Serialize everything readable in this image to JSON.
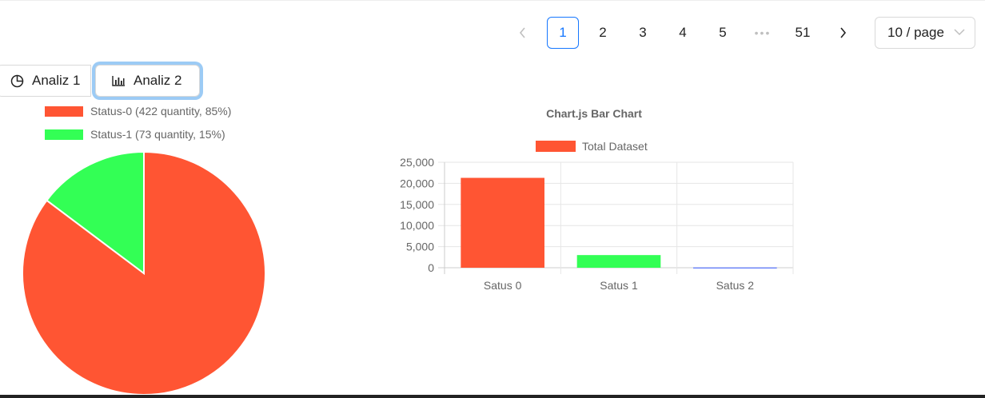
{
  "pagination": {
    "prev_icon": "chevron-left-icon",
    "next_icon": "chevron-right-icon",
    "pages": [
      "1",
      "2",
      "3",
      "4",
      "5"
    ],
    "ellipsis": "•••",
    "last_page": "51",
    "current": "1",
    "page_size": "10 / page"
  },
  "tabs": [
    {
      "label": "Analiz 1",
      "icon": "pie-chart-icon"
    },
    {
      "label": "Analiz 2",
      "icon": "bar-chart-icon",
      "focused": true
    }
  ],
  "colors": {
    "status0": "#ff5533",
    "status1": "#33ff55",
    "accent": "#1677ff"
  },
  "chart_data": [
    {
      "type": "pie",
      "labels": [
        "Status-0 (422 quantity, 85%)",
        "Status-1 (73 quantity, 15%)"
      ],
      "values": [
        422,
        73
      ],
      "colors": [
        "#ff5533",
        "#33ff55"
      ],
      "legend": "top"
    },
    {
      "type": "bar",
      "title": "Chart.js Bar Chart",
      "categories": [
        "Satus 0",
        "Satus 1",
        "Satus 2"
      ],
      "series": [
        {
          "name": "Total Dataset",
          "values": [
            21300,
            3000,
            50
          ],
          "colors": [
            "#ff5533",
            "#33ff55",
            "#3355ff"
          ]
        }
      ],
      "ylim": [
        0,
        25000
      ],
      "yticks": [
        "25,000",
        "20,000",
        "15,000",
        "10,000",
        "5,000",
        "0"
      ],
      "grid": true,
      "legend": "top"
    }
  ]
}
